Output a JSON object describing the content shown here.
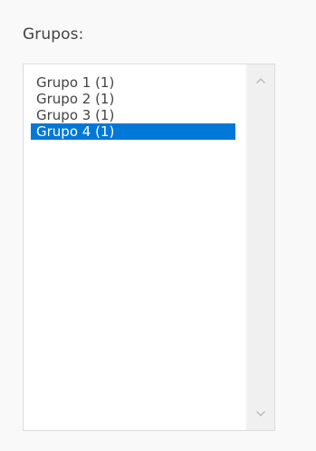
{
  "groups_field": {
    "label": "Grupos:",
    "options": [
      {
        "label": "Grupo 1 (1)",
        "selected": false
      },
      {
        "label": "Grupo 2 (1)",
        "selected": false
      },
      {
        "label": "Grupo 3 (1)",
        "selected": false
      },
      {
        "label": "Grupo 4 (1)",
        "selected": true
      }
    ],
    "scroll_up_icon": "chevron-up-icon",
    "scroll_down_icon": "chevron-down-icon"
  },
  "colors": {
    "selection_background": "#0078d7",
    "selection_text": "#ffffff",
    "text": "#444444",
    "background": "#f9f9f9"
  }
}
